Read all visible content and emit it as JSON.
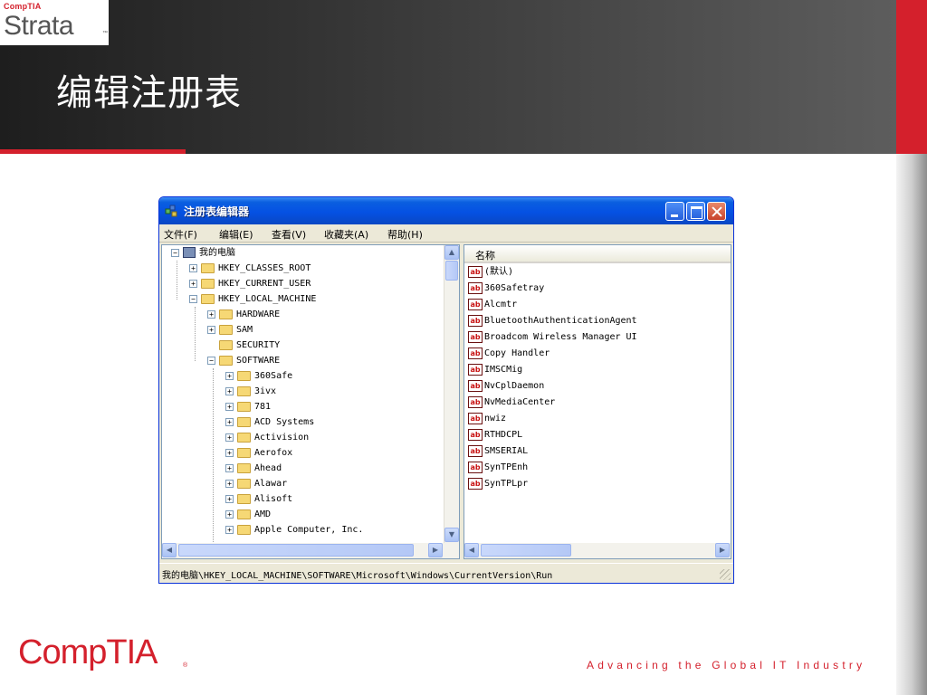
{
  "header": {
    "brand_top": "CompTIA",
    "brand_name": "Strata",
    "brand_tm": "™",
    "slide_title": "编辑注册表"
  },
  "window": {
    "title": "注册表编辑器",
    "menu": [
      "文件(F)",
      "编辑(E)",
      "查看(V)",
      "收藏夹(A)",
      "帮助(H)"
    ],
    "tree": [
      {
        "label": "我的电脑",
        "expander": "−",
        "icon": "computer-icon"
      },
      {
        "label": "HKEY_CLASSES_ROOT",
        "expander": "+",
        "icon": "folder-icon"
      },
      {
        "label": "HKEY_CURRENT_USER",
        "expander": "+",
        "icon": "folder-icon"
      },
      {
        "label": "HKEY_LOCAL_MACHINE",
        "expander": "−",
        "icon": "folder-icon"
      },
      {
        "label": "HARDWARE",
        "expander": "+",
        "icon": "folder-icon"
      },
      {
        "label": "SAM",
        "expander": "+",
        "icon": "folder-icon"
      },
      {
        "label": "SECURITY",
        "expander": "",
        "icon": "folder-icon"
      },
      {
        "label": "SOFTWARE",
        "expander": "−",
        "icon": "folder-icon"
      },
      {
        "label": "360Safe",
        "expander": "+",
        "icon": "folder-icon"
      },
      {
        "label": "3ivx",
        "expander": "+",
        "icon": "folder-icon"
      },
      {
        "label": "781",
        "expander": "+",
        "icon": "folder-icon"
      },
      {
        "label": "ACD Systems",
        "expander": "+",
        "icon": "folder-icon"
      },
      {
        "label": "Activision",
        "expander": "+",
        "icon": "folder-icon"
      },
      {
        "label": "Aerofox",
        "expander": "+",
        "icon": "folder-icon"
      },
      {
        "label": "Ahead",
        "expander": "+",
        "icon": "folder-icon"
      },
      {
        "label": "Alawar",
        "expander": "+",
        "icon": "folder-icon"
      },
      {
        "label": "Alisoft",
        "expander": "+",
        "icon": "folder-icon"
      },
      {
        "label": "AMD",
        "expander": "+",
        "icon": "folder-icon"
      },
      {
        "label": "Apple Computer, Inc.",
        "expander": "+",
        "icon": "folder-icon"
      }
    ],
    "list_header": "名称",
    "values": [
      {
        "icon": "ab",
        "name": "(默认)"
      },
      {
        "icon": "ab",
        "name": "360Safetray"
      },
      {
        "icon": "ab",
        "name": "Alcmtr"
      },
      {
        "icon": "ab",
        "name": "BluetoothAuthenticationAgent"
      },
      {
        "icon": "ab",
        "name": "Broadcom Wireless Manager UI"
      },
      {
        "icon": "ab",
        "name": "Copy Handler"
      },
      {
        "icon": "ab",
        "name": "IMSCMig"
      },
      {
        "icon": "ab",
        "name": "NvCplDaemon"
      },
      {
        "icon": "ab",
        "name": "NvMediaCenter"
      },
      {
        "icon": "ab",
        "name": "nwiz"
      },
      {
        "icon": "ab",
        "name": "RTHDCPL"
      },
      {
        "icon": "ab",
        "name": "SMSERIAL"
      },
      {
        "icon": "ab",
        "name": "SynTPEnh"
      },
      {
        "icon": "ab",
        "name": "SynTPLpr"
      }
    ],
    "status_path": "我的电脑\\HKEY_LOCAL_MACHINE\\SOFTWARE\\Microsoft\\Windows\\CurrentVersion\\Run"
  },
  "footer": {
    "logo": "CompTIA",
    "logo_reg": "®",
    "tagline": "Advancing the Global IT Industry"
  },
  "colors": {
    "accent_red": "#d4202c",
    "title_bar_blue": "#0551e3",
    "header_dark": "#2a2a2a"
  }
}
